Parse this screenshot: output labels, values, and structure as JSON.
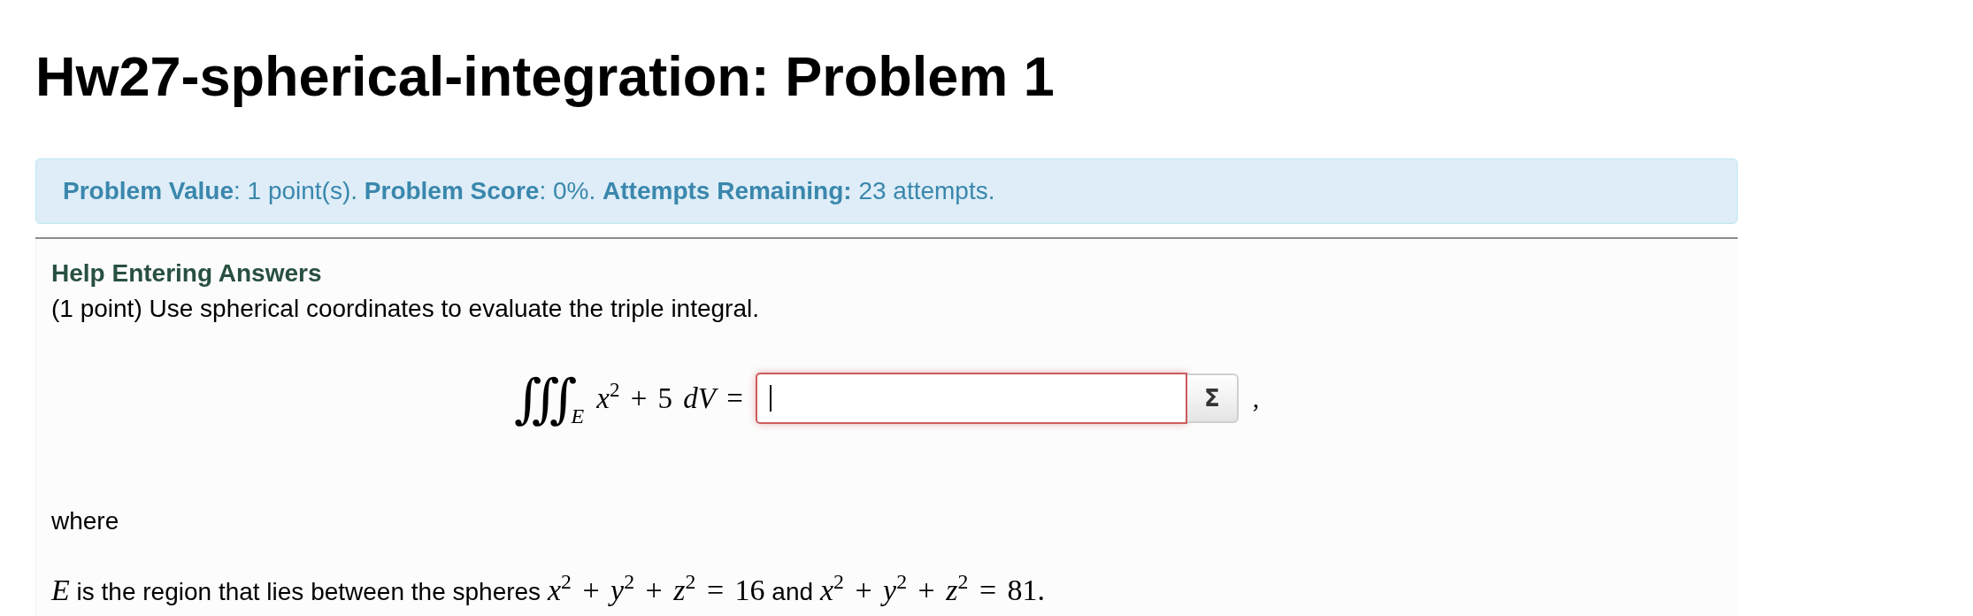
{
  "page": {
    "title": "Hw27-spherical-integration: Problem 1"
  },
  "score_banner": {
    "text": "**Problem Value**: 1 point(s). **Problem Score**: 0%. **Attempts Remaining:** 23 attempts."
  },
  "problem": {
    "help_link": "Help Entering Answers",
    "intro": "(1 point) Use spherical coordinates to evaluate the triple integral.",
    "equation": {
      "integral": "∭",
      "domain": "E",
      "integrand": "*x*$^{2}$ + 5 *dV* =",
      "answer": {
        "focused": true
      },
      "equation_button": "Σ",
      "trailing": ","
    },
    "where": "where",
    "region": [
      {
        "kind": "math",
        "text": "*E*"
      },
      {
        "kind": "text",
        "text": " is the region that lies between the spheres "
      },
      {
        "kind": "math",
        "text": "*x*$^{2}$ + *y*$^{2}$ + *z*$^{2}$ = 16"
      },
      {
        "kind": "text",
        "text": " and "
      },
      {
        "kind": "math",
        "text": "*x*$^{2}$ + *y*$^{2}$ + *z*$^{2}$ = 81."
      }
    ]
  }
}
